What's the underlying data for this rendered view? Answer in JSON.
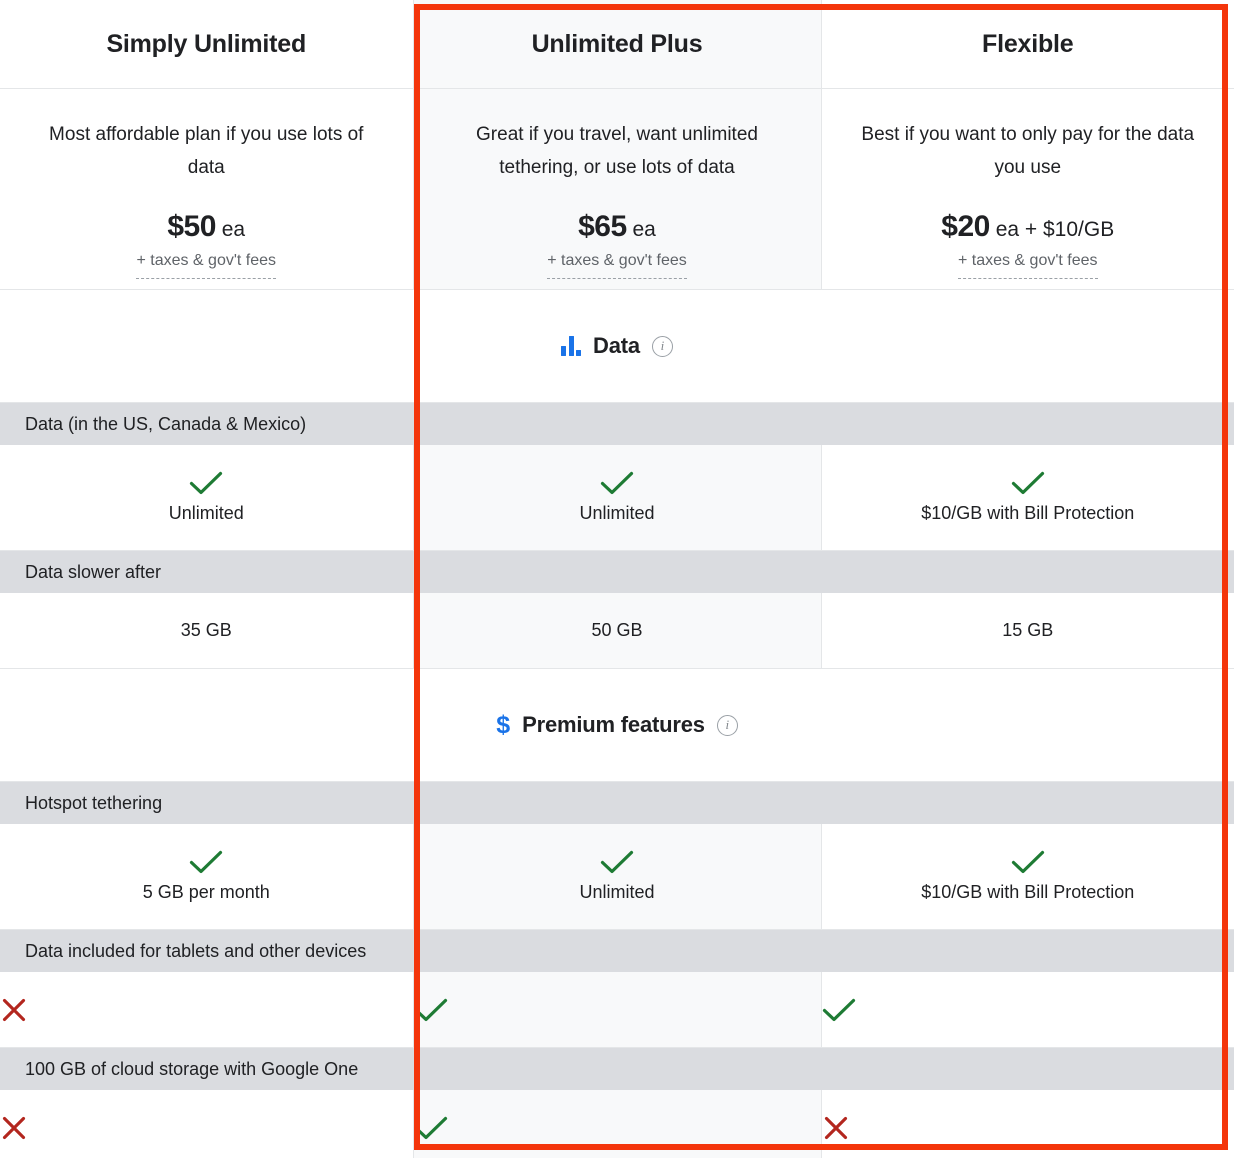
{
  "plans": [
    {
      "name": "Simply Unlimited",
      "tagline": "Most affordable plan if you use lots of data",
      "price_amount": "$50",
      "price_suffix": " ea",
      "taxes_note": "+ taxes & gov't fees",
      "highlighted": false
    },
    {
      "name": "Unlimited Plus",
      "tagline": "Great if you travel, want unlimited tethering, or use lots of data",
      "price_amount": "$65",
      "price_suffix": " ea",
      "taxes_note": "+ taxes & gov't fees",
      "highlighted": true
    },
    {
      "name": "Flexible",
      "tagline": "Best if you want to only pay for the data you use",
      "price_amount": "$20",
      "price_suffix": " ea + $10/GB",
      "taxes_note": "+ taxes & gov't fees",
      "highlighted": true
    }
  ],
  "sections": [
    {
      "id": "data",
      "title": "Data",
      "icon": "bar-chart-icon",
      "info_icon": "info-icon",
      "info_glyph": "i"
    },
    {
      "id": "premium",
      "title": "Premium features",
      "icon": "dollar-icon",
      "icon_glyph": "$",
      "info_icon": "info-icon",
      "info_glyph": "i"
    }
  ],
  "features": [
    {
      "label": "Data (in the US, Canada & Mexico)",
      "cells": [
        {
          "mark": "check",
          "text": "Unlimited"
        },
        {
          "mark": "check",
          "text": "Unlimited"
        },
        {
          "mark": "check",
          "text": "$10/GB with Bill Protection"
        }
      ]
    },
    {
      "label": "Data slower after",
      "cells": [
        {
          "mark": "none",
          "text": "35 GB"
        },
        {
          "mark": "none",
          "text": "50 GB"
        },
        {
          "mark": "none",
          "text": "15 GB"
        }
      ]
    },
    {
      "label": "Hotspot tethering",
      "cells": [
        {
          "mark": "check",
          "text": "5 GB per month"
        },
        {
          "mark": "check",
          "text": "Unlimited"
        },
        {
          "mark": "check",
          "text": "$10/GB with Bill Protection"
        }
      ]
    },
    {
      "label": "Data included for tablets and other devices",
      "cells": [
        {
          "mark": "cross",
          "text": ""
        },
        {
          "mark": "check",
          "text": ""
        },
        {
          "mark": "check",
          "text": ""
        }
      ]
    },
    {
      "label": "100 GB of cloud storage with Google One",
      "cells": [
        {
          "mark": "cross",
          "text": ""
        },
        {
          "mark": "check",
          "text": ""
        },
        {
          "mark": "cross",
          "text": ""
        }
      ]
    }
  ],
  "highlight": {
    "name": "selection-highlight",
    "color": "#f4350b"
  },
  "colors": {
    "check_green": "#1e7b34",
    "cross_red": "#b3261e",
    "accent_blue": "#1a73e8",
    "band_gray": "#dadce0",
    "tint_gray": "#f8f9fa",
    "text_primary": "#202124",
    "text_secondary": "#5f6368"
  }
}
